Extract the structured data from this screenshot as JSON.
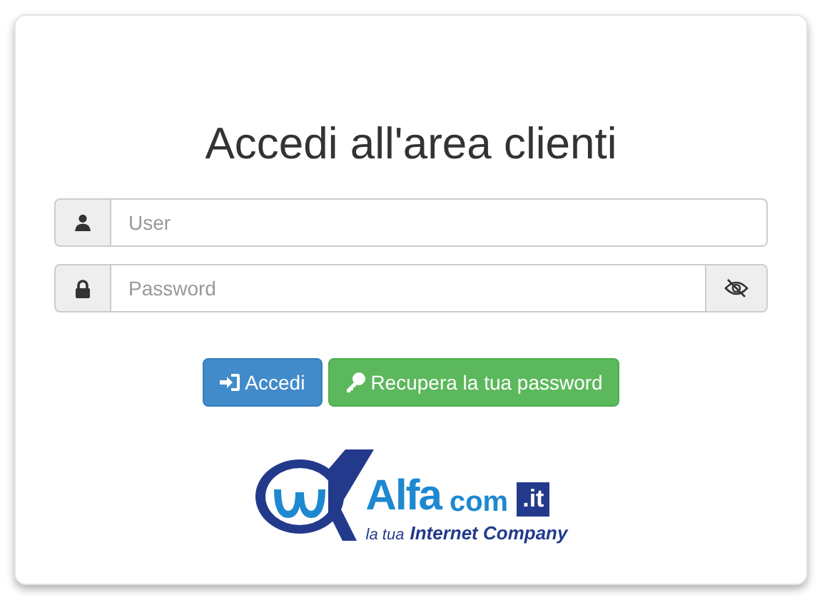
{
  "title": "Accedi all'area clienti",
  "fields": [
    {
      "kind": "user",
      "placeholder": "User"
    },
    {
      "kind": "password",
      "placeholder": "Password",
      "toggle": true
    }
  ],
  "buttons": [
    {
      "kind": "primary",
      "label": "Accedi"
    },
    {
      "kind": "success",
      "label": "Recupera la tua password"
    }
  ],
  "logo": {
    "name": "Alfa",
    "suffix": "com",
    "tld": ".it",
    "tagline_prefix": "la tua",
    "tagline": "Internet Company"
  }
}
